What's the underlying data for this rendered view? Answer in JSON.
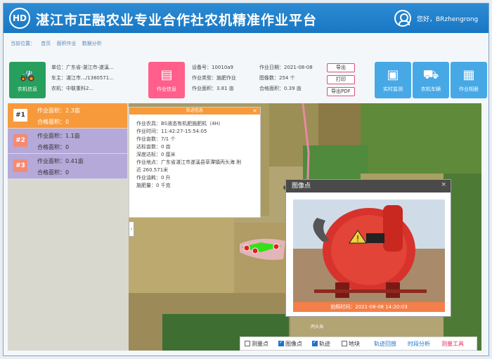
{
  "header": {
    "logo_text": "HD",
    "title": "湛江市正融农业专业合作社农机精准作业平台",
    "greeting": "您好，BRzhengrong"
  },
  "breadcrumb": [
    "当前位置：",
    "首页",
    "面积作业",
    "数据分析"
  ],
  "machine": {
    "button_label": "农机信息",
    "unit": "单位：广东省-湛江市-遂溪...",
    "vehicle": "车主：湛江市.../1380571...",
    "implement": "农机：中联重科2..."
  },
  "task": {
    "button_label": "作业信息",
    "device_no": "设备号：10010a9",
    "work_type": "作业类型：施肥作业",
    "work_area": "作业面积：3.81 亩",
    "work_date": "作业日期：2021-08-08",
    "photo_count": "图像数：254 个",
    "qualified_area": "合格面积：0.39 亩"
  },
  "actions": {
    "export": "导出",
    "print": "打印",
    "export_pdf": "导出PDF",
    "monitor": "实时监测",
    "dispatch": "农机车辆",
    "records": "作业相册"
  },
  "area_list": [
    {
      "index": "#1",
      "area": "作业面积：2.3亩",
      "qualified": "合格面积：0"
    },
    {
      "index": "#2",
      "area": "作业面积：1.1亩",
      "qualified": "合格面积：0"
    },
    {
      "index": "#3",
      "area": "作业面积：0.41亩",
      "qualified": "合格面积：0"
    }
  ],
  "detail_popup": {
    "title": "轨迹信息",
    "rows": [
      "作业农具：BS液态有机肥施肥机（4H）",
      "作业时间：11:42:27-15:54:05",
      "作业亩数：7/1 个",
      "达标亩数：0 亩",
      "深度达标：0 厘米",
      "作业地点：广东省湛江市遂溪县草潭镇丙头海 附",
      "近 260.571米",
      "作业油耗：0 升",
      "施肥量：0 千克"
    ]
  },
  "photo_popup": {
    "title": "图像点",
    "caption": "拍照时间：2021-08-08 14:20:03",
    "warning_text": "危险"
  },
  "map_label": "丙头海",
  "toolbar": {
    "items": [
      {
        "label": "测量点",
        "checked": false
      },
      {
        "label": "图像点",
        "checked": true
      },
      {
        "label": "轨迹",
        "checked": true
      },
      {
        "label": "地块",
        "checked": false
      }
    ],
    "playback": "轨迹回放",
    "time_analysis": "时段分析",
    "measure": "测量工具"
  },
  "colors": {
    "header_blue": "#1877c4",
    "machine_green": "#26a05c",
    "task_pink": "#ff5f8a",
    "action_blue": "#47a8e6",
    "active_orange": "#f79a3c",
    "list_purple": "#b5a9d9",
    "track_green": "#34e01c"
  }
}
